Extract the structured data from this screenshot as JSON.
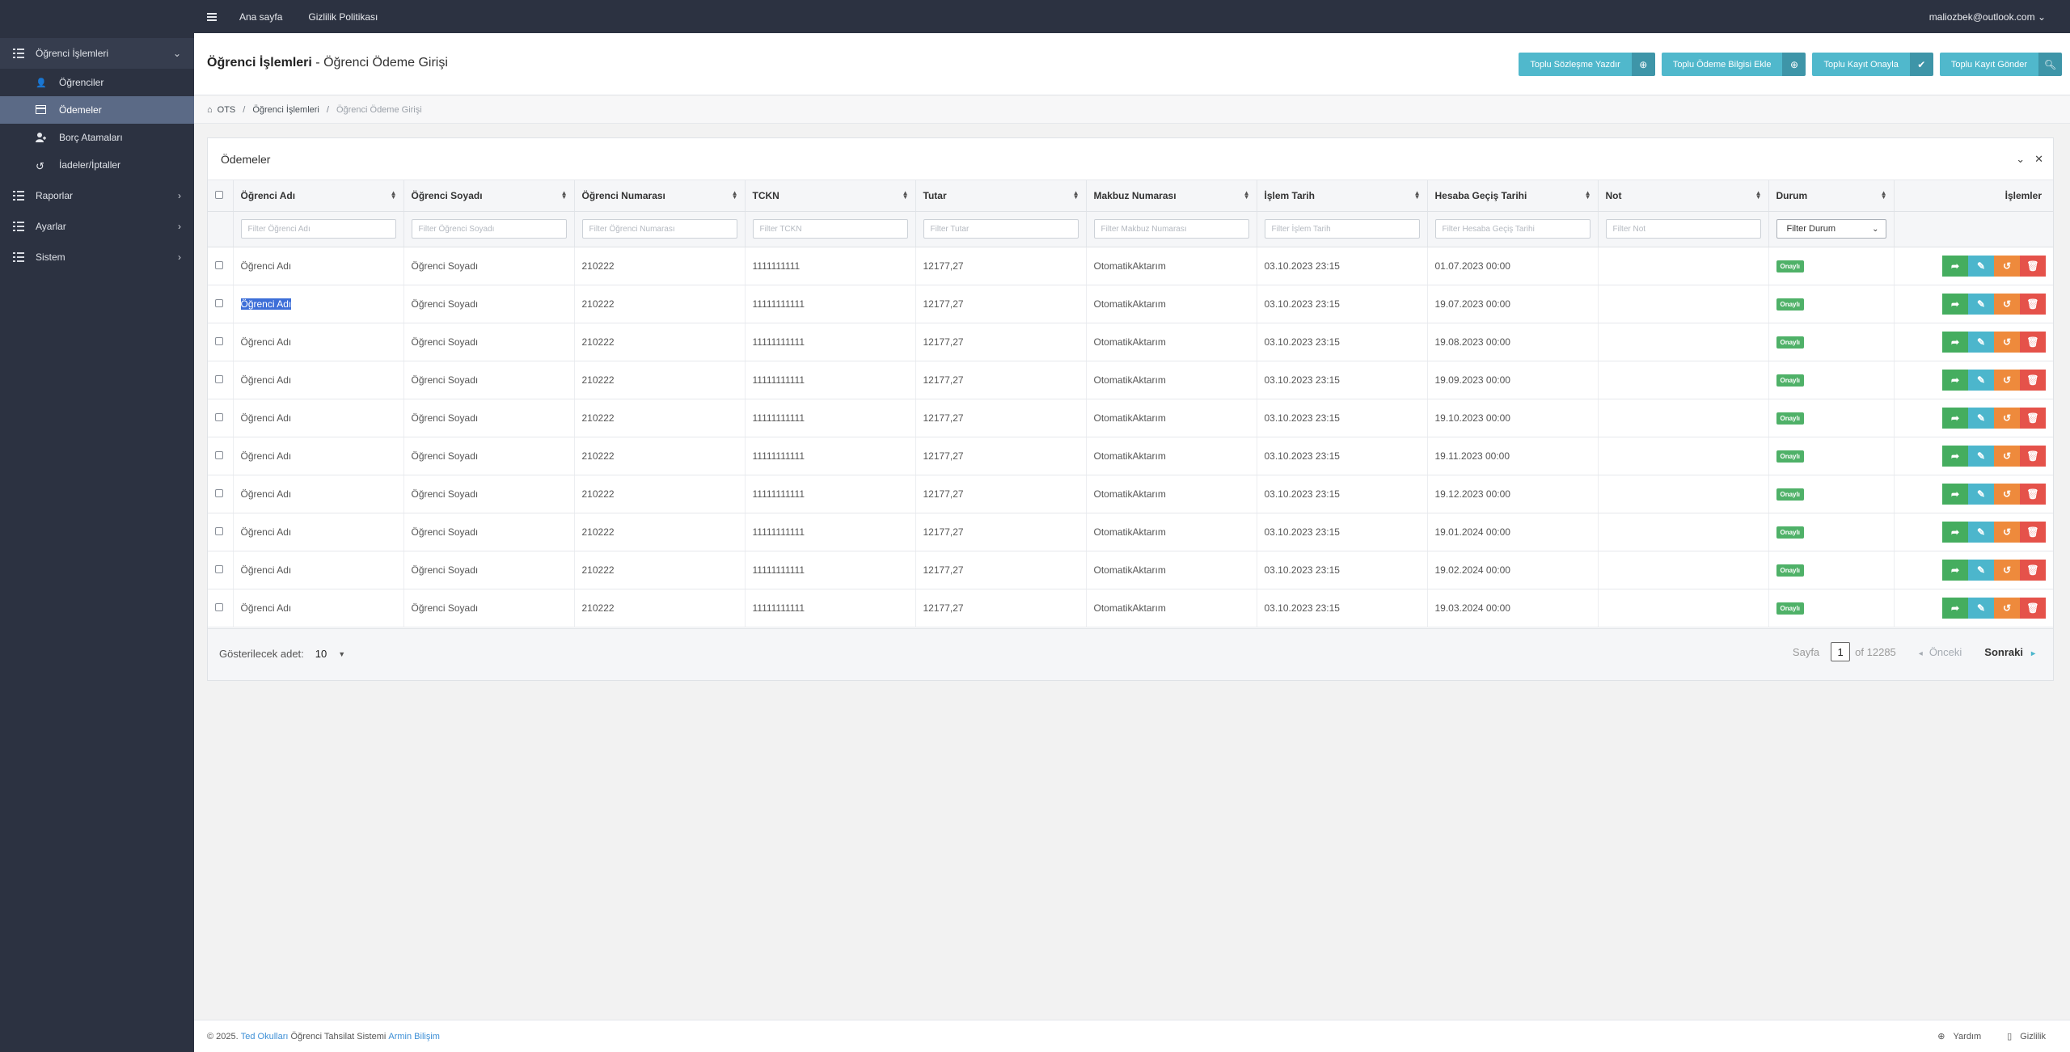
{
  "sidebar": {
    "group_student": "Öğrenci İşlemleri",
    "sub": [
      "Öğrenciler",
      "Ödemeler",
      "Borç Atamaları",
      "İadeler/İptaller"
    ],
    "reports": "Raporlar",
    "settings": "Ayarlar",
    "system": "Sistem"
  },
  "topbar": {
    "home": "Ana sayfa",
    "privacy": "Gizlilik Politikası",
    "user": "maliozbek@outlook.com"
  },
  "page": {
    "title_bold": "Öğrenci İşlemleri",
    "title_rest": " - Öğrenci Ödeme Girişi"
  },
  "buttons": {
    "b1": "Toplu Sözleşme Yazdır",
    "b2": "Toplu Ödeme Bilgisi Ekle",
    "b3": "Toplu Kayıt Onayla",
    "b4": "Toplu Kayıt Gönder"
  },
  "breadcrumb": {
    "c1": "OTS",
    "c2": "Öğrenci İşlemleri",
    "c3": "Öğrenci Ödeme Girişi"
  },
  "panel": {
    "title": "Ödemeler"
  },
  "columns": [
    "Öğrenci Adı",
    "Öğrenci Soyadı",
    "Öğrenci Numarası",
    "TCKN",
    "Tutar",
    "Makbuz Numarası",
    "İşlem Tarih",
    "Hesaba Geçiş Tarihi",
    "Not",
    "Durum",
    "İşlemler"
  ],
  "filters": [
    "Filter Öğrenci Adı",
    "Filter Öğrenci Soyadı",
    "Filter Öğrenci Numarası",
    "Filter TCKN",
    "Filter Tutar",
    "Filter Makbuz Numarası",
    "Filter İşlem Tarih",
    "Filter Hesaba Geçiş Tarihi",
    "Filter Not",
    "Filter Durum"
  ],
  "rows": [
    {
      "ad": "Öğrenci Adı",
      "soyad": "Öğrenci Soyadı",
      "no": "210222",
      "tckn": "1111111111",
      "tutar": "12177,27",
      "makbuz": "OtomatikAktarım",
      "islem": "03.10.2023 23:15",
      "gecis": "01.07.2023 00:00",
      "not": "",
      "durum": "Onaylı"
    },
    {
      "ad": "Öğrenci Adı",
      "soyad": "Öğrenci Soyadı",
      "no": "210222",
      "tckn": "11111111111",
      "tutar": "12177,27",
      "makbuz": "OtomatikAktarım",
      "islem": "03.10.2023 23:15",
      "gecis": "19.07.2023 00:00",
      "not": "",
      "durum": "Onaylı"
    },
    {
      "ad": "Öğrenci Adı",
      "soyad": "Öğrenci Soyadı",
      "no": "210222",
      "tckn": "11111111111",
      "tutar": "12177,27",
      "makbuz": "OtomatikAktarım",
      "islem": "03.10.2023 23:15",
      "gecis": "19.08.2023 00:00",
      "not": "",
      "durum": "Onaylı"
    },
    {
      "ad": "Öğrenci Adı",
      "soyad": "Öğrenci Soyadı",
      "no": "210222",
      "tckn": "11111111111",
      "tutar": "12177,27",
      "makbuz": "OtomatikAktarım",
      "islem": "03.10.2023 23:15",
      "gecis": "19.09.2023 00:00",
      "not": "",
      "durum": "Onaylı"
    },
    {
      "ad": "Öğrenci Adı",
      "soyad": "Öğrenci Soyadı",
      "no": "210222",
      "tckn": "11111111111",
      "tutar": "12177,27",
      "makbuz": "OtomatikAktarım",
      "islem": "03.10.2023 23:15",
      "gecis": "19.10.2023 00:00",
      "not": "",
      "durum": "Onaylı"
    },
    {
      "ad": "Öğrenci Adı",
      "soyad": "Öğrenci Soyadı",
      "no": "210222",
      "tckn": "11111111111",
      "tutar": "12177,27",
      "makbuz": "OtomatikAktarım",
      "islem": "03.10.2023 23:15",
      "gecis": "19.11.2023 00:00",
      "not": "",
      "durum": "Onaylı"
    },
    {
      "ad": "Öğrenci Adı",
      "soyad": "Öğrenci Soyadı",
      "no": "210222",
      "tckn": "11111111111",
      "tutar": "12177,27",
      "makbuz": "OtomatikAktarım",
      "islem": "03.10.2023 23:15",
      "gecis": "19.12.2023 00:00",
      "not": "",
      "durum": "Onaylı"
    },
    {
      "ad": "Öğrenci Adı",
      "soyad": "Öğrenci Soyadı",
      "no": "210222",
      "tckn": "11111111111",
      "tutar": "12177,27",
      "makbuz": "OtomatikAktarım",
      "islem": "03.10.2023 23:15",
      "gecis": "19.01.2024 00:00",
      "not": "",
      "durum": "Onaylı"
    },
    {
      "ad": "Öğrenci Adı",
      "soyad": "Öğrenci Soyadı",
      "no": "210222",
      "tckn": "11111111111",
      "tutar": "12177,27",
      "makbuz": "OtomatikAktarım",
      "islem": "03.10.2023 23:15",
      "gecis": "19.02.2024 00:00",
      "not": "",
      "durum": "Onaylı"
    },
    {
      "ad": "Öğrenci Adı",
      "soyad": "Öğrenci Soyadı",
      "no": "210222",
      "tckn": "11111111111",
      "tutar": "12177,27",
      "makbuz": "OtomatikAktarım",
      "islem": "03.10.2023 23:15",
      "gecis": "19.03.2024 00:00",
      "not": "",
      "durum": "Onaylı"
    }
  ],
  "pager": {
    "show_label": "Gösterilecek adet:",
    "page_size": "10",
    "page_label": "Sayfa",
    "page": "1",
    "of": "of 12285",
    "prev": "Önceki",
    "next": "Sonraki"
  },
  "footer": {
    "copy": "© 2025.",
    "brand": "Ted Okulları",
    "system": "Öğrenci Tahsilat Sistemi",
    "vendor": "Armin Bilişim",
    "help": "Yardım",
    "privacy": "Gizlilik"
  },
  "colors": {
    "sidebar_bg": "#2c3241",
    "active_item": "#5b6a86",
    "info": "#50b8cc",
    "success": "#45ad5f",
    "warning": "#ee8a3c",
    "danger": "#e5524a"
  },
  "icons": [
    "menu-icon",
    "list-icon",
    "user-icon",
    "credit-card-icon",
    "user-plus-icon",
    "undo-icon",
    "home-icon",
    "plus-circle-icon",
    "check-icon",
    "search-icon",
    "share-icon",
    "edit-icon",
    "trash-icon",
    "chevron-down-icon",
    "close-icon",
    "globe-icon",
    "file-icon"
  ]
}
